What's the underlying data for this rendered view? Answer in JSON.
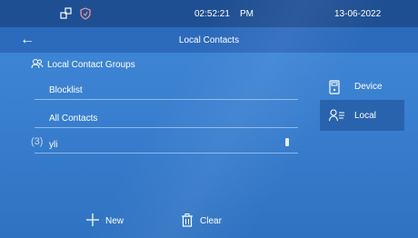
{
  "status": {
    "time": "02:52:21",
    "ampm": "PM",
    "date": "13-06-2022"
  },
  "header": {
    "title": "Local Contacts"
  },
  "groups": {
    "heading": "Local Contact Groups"
  },
  "list": [
    {
      "label": "Blocklist"
    },
    {
      "label": "All Contacts"
    },
    {
      "number": "3",
      "label": "yli"
    }
  ],
  "side": {
    "device": "Device",
    "local": "Local"
  },
  "footer": {
    "new": "New",
    "clear": "Clear"
  }
}
